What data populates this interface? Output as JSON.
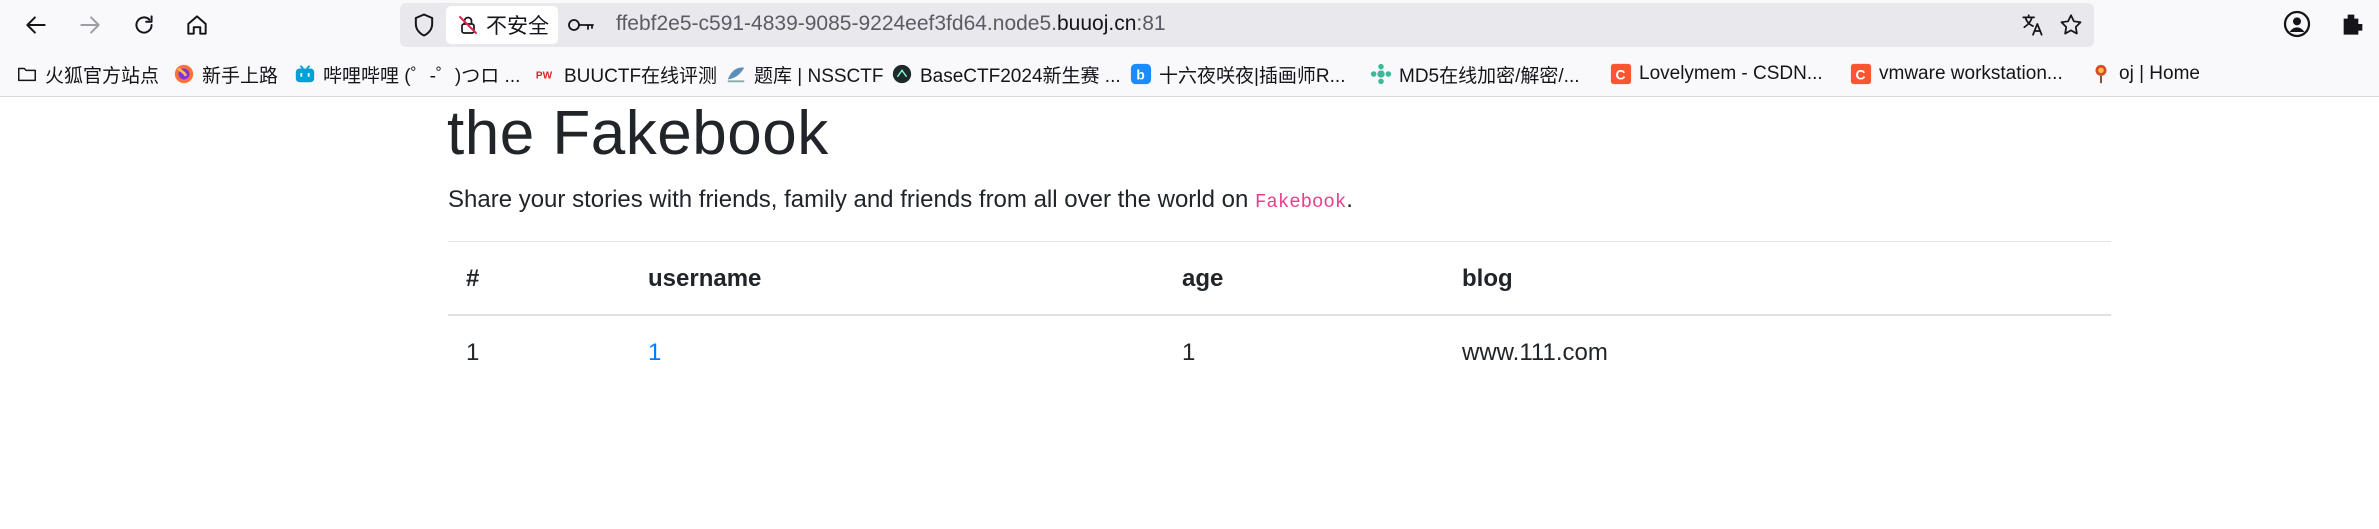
{
  "browser": {
    "security_label": "不安全",
    "url_prefix": "ffebf2e5-c591-4839-9085-9224eef3fd64.node5.",
    "url_domain": "buuoj.cn",
    "url_suffix": ":81",
    "icons": [
      "back-icon",
      "forward-icon",
      "reload-icon",
      "home-icon",
      "shield-icon",
      "insecure-lock-icon",
      "key-icon",
      "translate-icon",
      "star-icon",
      "account-icon",
      "extensions-icon"
    ]
  },
  "bookmarks": [
    {
      "label": "火狐官方站点",
      "icon": "folder-icon"
    },
    {
      "label": "新手上路",
      "icon": "firefox-icon"
    },
    {
      "label": "哔哩哔哩 (゜-゜)つロ ...",
      "icon": "bilibili-icon"
    },
    {
      "label": "BUUCTF在线评测",
      "icon": "buuctf-icon"
    },
    {
      "label": "题库 | NSSCTF",
      "icon": "nssctf-icon"
    },
    {
      "label": "BaseCTF2024新生赛 ...",
      "icon": "basectf-icon"
    },
    {
      "label": "十六夜咲夜|插画师R...",
      "icon": "b-icon"
    },
    {
      "label": "MD5在线加密/解密/...",
      "icon": "md5-icon"
    },
    {
      "label": "Lovelymem - CSDN...",
      "icon": "csdn-icon"
    },
    {
      "label": "vmware workstation...",
      "icon": "csdn-icon"
    },
    {
      "label": "oj | Home",
      "icon": "oj-icon"
    }
  ],
  "page": {
    "title": "the Fakebook",
    "lead_text": "Share your stories with friends, family and friends from all over the world on ",
    "lead_code": "Fakebook",
    "lead_end": "."
  },
  "table": {
    "headers": [
      "#",
      "username",
      "age",
      "blog"
    ],
    "rows": [
      {
        "id": "1",
        "username": "1",
        "age": "1",
        "blog": "www.111.com"
      }
    ]
  },
  "colors": {
    "accent_link": "#007bff",
    "code_pink": "#e83e8c",
    "toolbar_bg": "#f9f9fb",
    "urlbar_bg": "#e9e9ed"
  }
}
